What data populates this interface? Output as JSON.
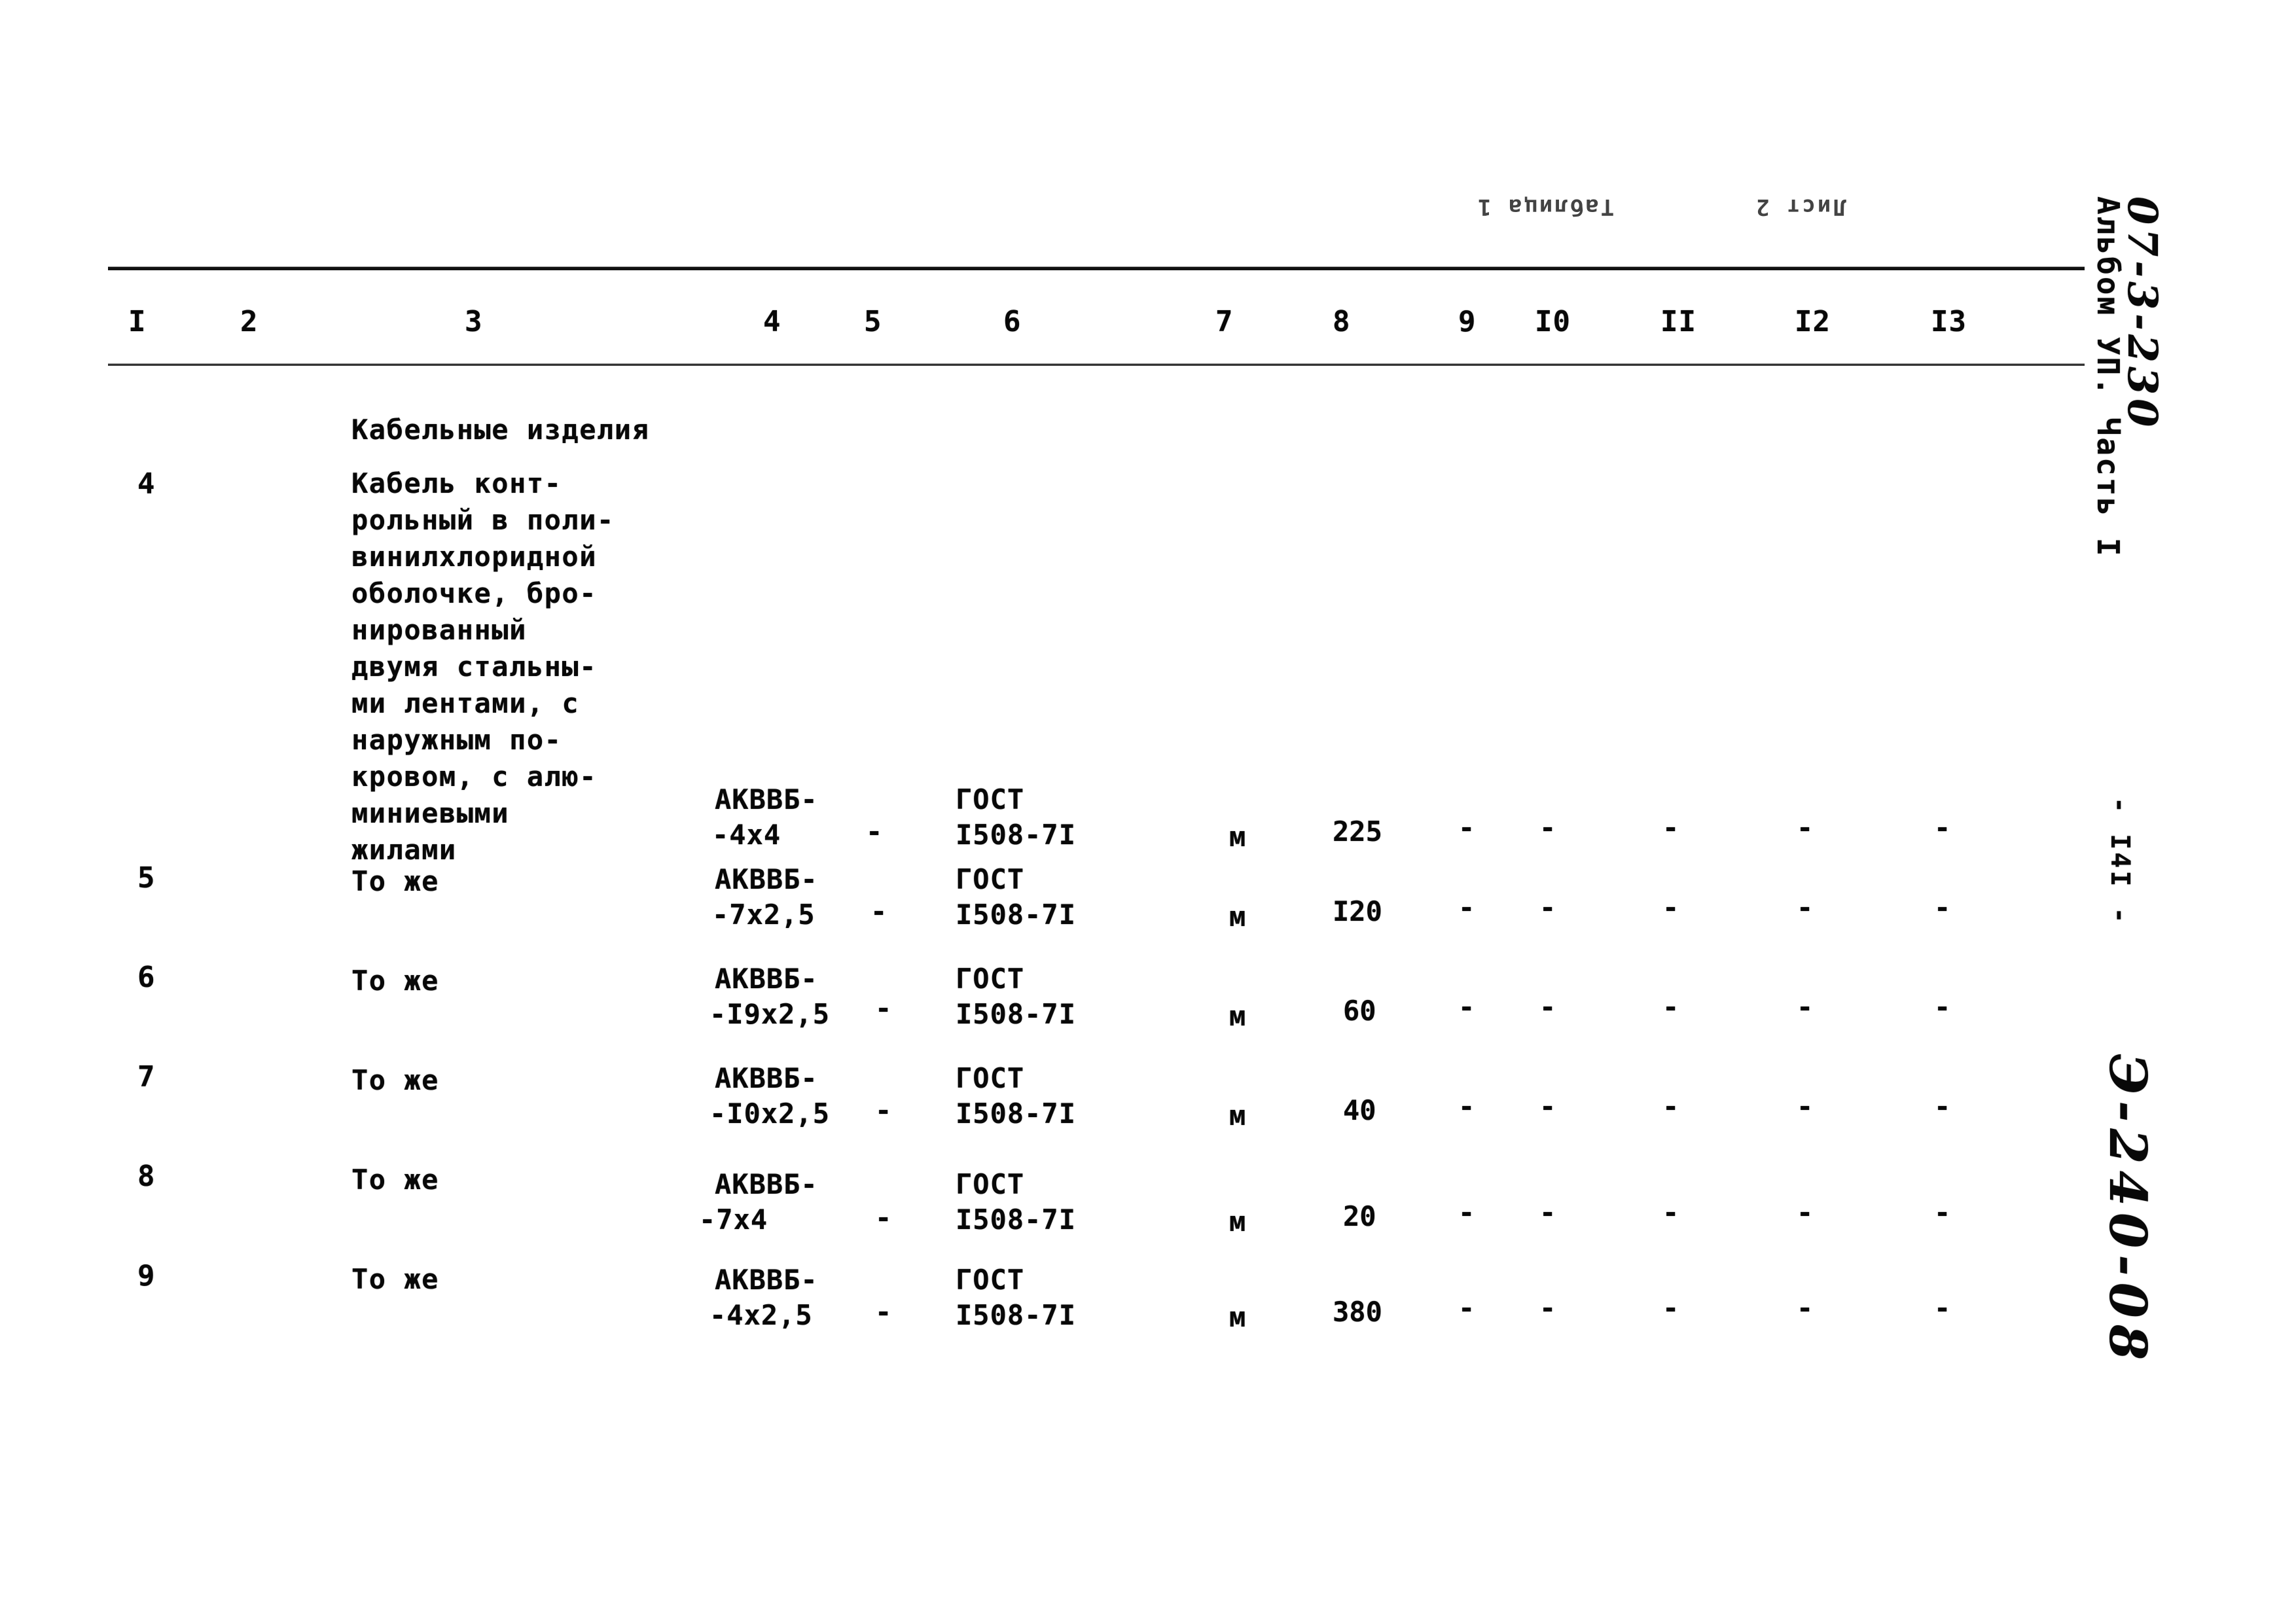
{
  "document": {
    "kind": "scanned-specification-table",
    "bleed_through_top": {
      "left": "Таблица 1",
      "right": "Лист 2"
    },
    "margin": {
      "album_code": "07-3-230",
      "album_line": "Альбом УП. Часть I",
      "page_marker": "- I4I -",
      "archive_mark": "Э-240-08"
    }
  },
  "table": {
    "column_headers": [
      "I",
      "2",
      "3",
      "4",
      "5",
      "6",
      "7",
      "8",
      "9",
      "I0",
      "II",
      "I2",
      "I3"
    ],
    "section_title": "Кабельные изделия",
    "rows": [
      {
        "num": "4",
        "name_lines": [
          "Кабель конт-",
          "рольный в поли-",
          "винилхлоридной",
          "оболочке, бро-",
          "нированный",
          "двумя стальны-",
          "ми лентами, с",
          "наружным по-",
          "кровом, с алю-",
          "миниевыми",
          "жилами"
        ],
        "mark_line1": "АКВВБ-",
        "mark_line2": "-4х4",
        "col5": "-",
        "standard_line1": "ГОСТ",
        "standard_line2": "I508-7I",
        "unit": "м",
        "quantity": "225",
        "trailing_dashes": [
          "-",
          "-",
          "-",
          "-",
          "-"
        ]
      },
      {
        "num": "5",
        "name_lines": [
          "То же"
        ],
        "mark_line1": "АКВВБ-",
        "mark_line2": "-7х2,5",
        "col5": "-",
        "standard_line1": "ГОСТ",
        "standard_line2": "I508-7I",
        "unit": "м",
        "quantity": "I20",
        "trailing_dashes": [
          "-",
          "-",
          "-",
          "-",
          "-"
        ]
      },
      {
        "num": "6",
        "name_lines": [
          "То же"
        ],
        "mark_line1": "АКВВБ-",
        "mark_line2": "-I9х2,5",
        "col5": "-",
        "standard_line1": "ГОСТ",
        "standard_line2": "I508-7I",
        "unit": "м",
        "quantity": "60",
        "trailing_dashes": [
          "-",
          "-",
          "-",
          "-",
          "-"
        ]
      },
      {
        "num": "7",
        "name_lines": [
          "То же"
        ],
        "mark_line1": "АКВВБ-",
        "mark_line2": "-I0х2,5",
        "col5": "-",
        "standard_line1": "ГОСТ",
        "standard_line2": "I508-7I",
        "unit": "м",
        "quantity": "40",
        "trailing_dashes": [
          "-",
          "-",
          "-",
          "-",
          "-"
        ]
      },
      {
        "num": "8",
        "name_lines": [
          "То же"
        ],
        "mark_line1": "АКВВБ-",
        "mark_line2": "-7х4",
        "col5": "-",
        "standard_line1": "ГОСТ",
        "standard_line2": "I508-7I",
        "unit": "м",
        "quantity": "20",
        "trailing_dashes": [
          "-",
          "-",
          "-",
          "-",
          "-"
        ]
      },
      {
        "num": "9",
        "name_lines": [
          "То же"
        ],
        "mark_line1": "АКВВБ-",
        "mark_line2": "-4х2,5",
        "col5": "-",
        "standard_line1": "ГОСТ",
        "standard_line2": "I508-7I",
        "unit": "м",
        "quantity": "380",
        "trailing_dashes": [
          "-",
          "-",
          "-",
          "-",
          "-"
        ]
      }
    ]
  }
}
